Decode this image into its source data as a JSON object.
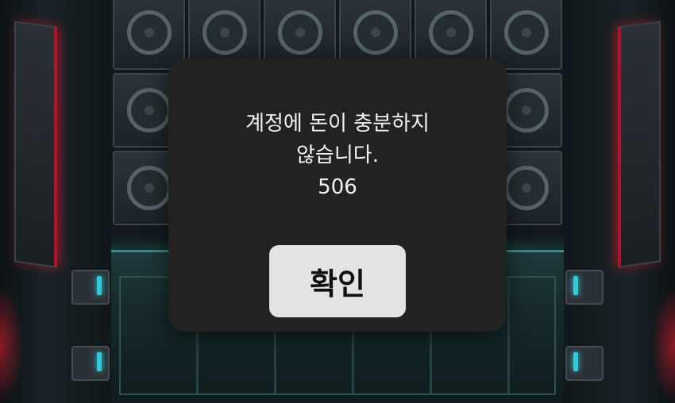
{
  "dialog": {
    "message_line1": "계정에 돈이 충분하지",
    "message_line2": "않습니다.",
    "error_code": "506",
    "confirm_label": "확인"
  },
  "colors": {
    "dialog_bg": "#222222",
    "button_bg": "#e3e3e3",
    "accent_red": "#b3132a",
    "accent_cyan": "#35c8d8"
  }
}
